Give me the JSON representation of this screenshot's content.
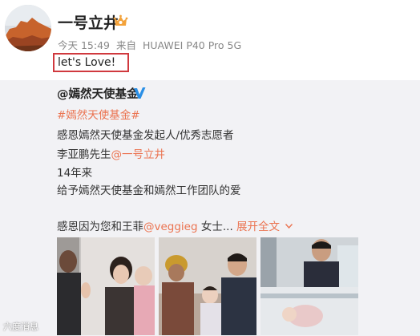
{
  "post": {
    "username": "一号立井",
    "time": "今天 15:49",
    "source_prefix": "来自",
    "source_device": "HUAWEI P40 Pro 5G",
    "text": "let's Love!"
  },
  "repost": {
    "author": "@嫣然天使基金",
    "hashtag": "#嫣然天使基金#",
    "line2": "感恩嫣然天使基金发起人/优秀志愿者",
    "line3_prefix": "李亚鹏先生",
    "line3_mention": "@一号立井",
    "line4": "14年来",
    "line5": "给予嫣然天使基金和嫣然工作团队的爱",
    "line6_prefix": "感恩因为您和王菲",
    "line6_mention": "@veggieg",
    "line6_suffix": "女士...",
    "expand_label": "展开全文",
    "expand_icon": "chevron-down-icon"
  },
  "watermark": "六度消息",
  "colors": {
    "link": "#eb7350",
    "highlight_box": "#d0393e",
    "repost_bg": "#f2f2f5",
    "verified_blue": "#2a8fe6"
  }
}
